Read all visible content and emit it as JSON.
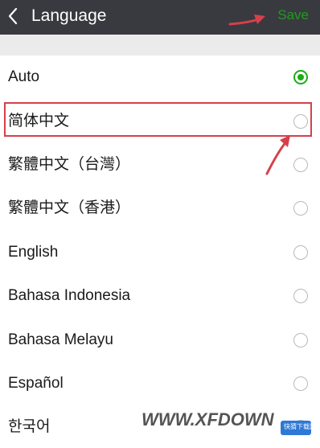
{
  "header": {
    "title": "Language",
    "save_label": "Save",
    "back_icon": "chevron-left-icon"
  },
  "languages": [
    {
      "label": "Auto",
      "selected": true
    },
    {
      "label": "简体中文",
      "selected": false
    },
    {
      "label": "繁體中文（台灣）",
      "selected": false
    },
    {
      "label": "繁體中文（香港）",
      "selected": false
    },
    {
      "label": "English",
      "selected": false
    },
    {
      "label": "Bahasa Indonesia",
      "selected": false
    },
    {
      "label": "Bahasa Melayu",
      "selected": false
    },
    {
      "label": "Español",
      "selected": false
    },
    {
      "label": "한국어",
      "selected": false
    }
  ],
  "watermark": {
    "text": "WWW.XFDOWN",
    "logo_text": "快猜下载网"
  },
  "colors": {
    "header_bg": "#393a3f",
    "accent": "#1aad19",
    "annotation": "#d6404b"
  }
}
